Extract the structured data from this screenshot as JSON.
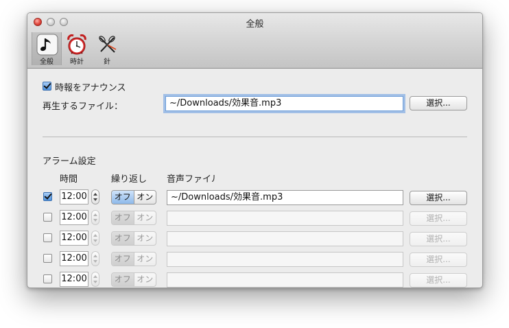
{
  "window": {
    "title": "全般"
  },
  "toolbar": {
    "items": [
      {
        "label": "全般",
        "icon": "music-note-icon",
        "selected": true
      },
      {
        "label": "時計",
        "icon": "alarm-clock-icon",
        "selected": false
      },
      {
        "label": "針",
        "icon": "clock-hands-icon",
        "selected": false
      }
    ]
  },
  "announce": {
    "checkbox_label": "時報をアナウンス",
    "checked": true,
    "file_label": "再生するファイル：",
    "file_value": "~/Downloads/効果音.mp3",
    "select_button": "選択..."
  },
  "alarm": {
    "section_title": "アラーム設定",
    "columns": {
      "time": "時間",
      "repeat": "繰り返し",
      "sound": "音声ファイル"
    },
    "rows": [
      {
        "enabled": true,
        "time": "12:00",
        "repeat_off": "オフ",
        "repeat_on": "オン",
        "file": "~/Downloads/効果音.mp3",
        "button": "選択..."
      },
      {
        "enabled": false,
        "time": "12:00",
        "repeat_off": "オフ",
        "repeat_on": "オン",
        "file": "",
        "button": "選択..."
      },
      {
        "enabled": false,
        "time": "12:00",
        "repeat_off": "オフ",
        "repeat_on": "オン",
        "file": "",
        "button": "選択..."
      },
      {
        "enabled": false,
        "time": "12:00",
        "repeat_off": "オフ",
        "repeat_on": "オン",
        "file": "",
        "button": "選択..."
      },
      {
        "enabled": false,
        "time": "12:00",
        "repeat_off": "オフ",
        "repeat_on": "オン",
        "file": "",
        "button": "選択..."
      }
    ]
  },
  "colors": {
    "accent": "#4e92dd",
    "close": "#e0443a",
    "window_bg": "#ececec"
  }
}
